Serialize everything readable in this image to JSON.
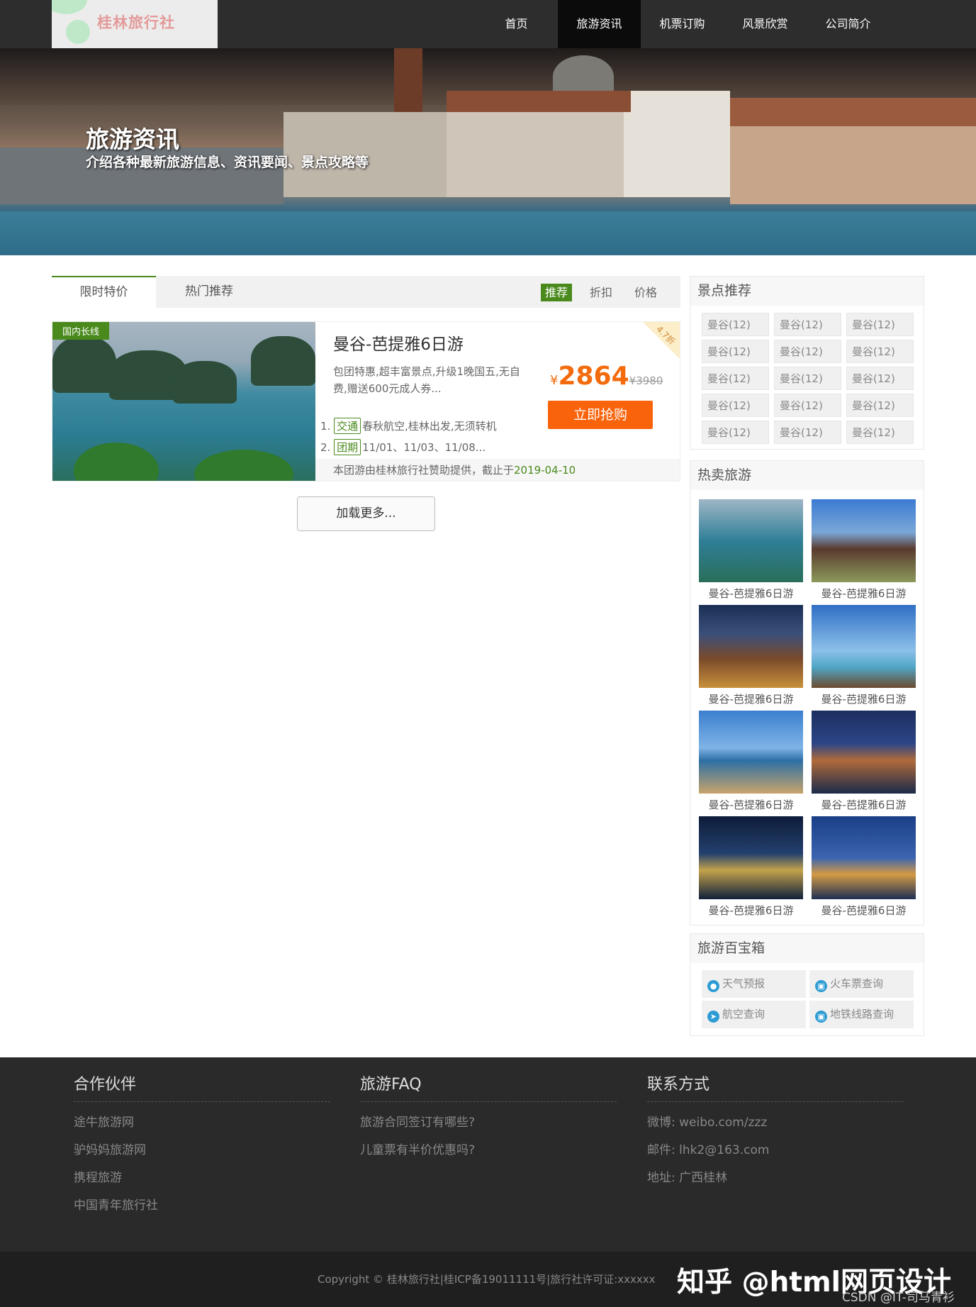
{
  "brand": {
    "logo_text": "桂林旅行社"
  },
  "nav": {
    "items": [
      "首页",
      "旅游资讯",
      "机票订购",
      "风景欣赏",
      "公司简介"
    ],
    "active_index": 1
  },
  "banner": {
    "title": "旅游资讯",
    "subtitle": "介绍各种最新旅游信息、资讯要闻、景点攻略等"
  },
  "tabs": {
    "items": [
      "限时特价",
      "热门推荐"
    ],
    "active_index": 0
  },
  "sorts": {
    "items": [
      "推荐",
      "折扣",
      "价格"
    ],
    "active_index": 0
  },
  "product": {
    "tag": "国内长线",
    "discount": "4.7折",
    "title": "曼谷-芭提雅6日游",
    "desc": "包团特惠,超丰富景点,升级1晚国五,无自费,赠送600元成人券...",
    "currency": "¥",
    "price": "2864",
    "old_price": "¥3980",
    "buy_label": "立即抢购",
    "features": [
      {
        "num": "1.",
        "label": "交通",
        "text": "春秋航空,桂林出发,无须转机"
      },
      {
        "num": "2.",
        "label": "团期",
        "text": "11/01、11/03、11/08..."
      }
    ],
    "foot_text": "本团游由桂林旅行社赞助提供，截止于",
    "foot_date": "2019-04-10"
  },
  "load_more": "加载更多...",
  "spots": {
    "title": "景点推荐",
    "items": [
      "曼谷(12)",
      "曼谷(12)",
      "曼谷(12)",
      "曼谷(12)",
      "曼谷(12)",
      "曼谷(12)",
      "曼谷(12)",
      "曼谷(12)",
      "曼谷(12)",
      "曼谷(12)",
      "曼谷(12)",
      "曼谷(12)",
      "曼谷(12)",
      "曼谷(12)",
      "曼谷(12)"
    ]
  },
  "hot": {
    "title": "热卖旅游",
    "items": [
      {
        "caption": "曼谷-芭提雅6日游",
        "scene": "bay"
      },
      {
        "caption": "曼谷-芭提雅6日游",
        "scene": "temple"
      },
      {
        "caption": "曼谷-芭提雅6日游",
        "scene": "night-temple"
      },
      {
        "caption": "曼谷-芭提雅6日游",
        "scene": "palm-beach"
      },
      {
        "caption": "曼谷-芭提雅6日游",
        "scene": "rock-beach"
      },
      {
        "caption": "曼谷-芭提雅6日游",
        "scene": "aqueduct"
      },
      {
        "caption": "曼谷-芭提雅6日游",
        "scene": "harbor-night"
      },
      {
        "caption": "曼谷-芭提雅6日游",
        "scene": "city-night"
      }
    ]
  },
  "toolbox": {
    "title": "旅游百宝箱",
    "items": [
      {
        "label": "天气预报",
        "icon": "location-icon"
      },
      {
        "label": "火车票查询",
        "icon": "train-icon"
      },
      {
        "label": "航空查询",
        "icon": "plane-icon"
      },
      {
        "label": "地铁线路查询",
        "icon": "metro-icon"
      }
    ]
  },
  "footer": {
    "partners": {
      "title": "合作伙伴",
      "items": [
        "途牛旅游网",
        "驴妈妈旅游网",
        "携程旅游",
        "中国青年旅行社"
      ]
    },
    "faq": {
      "title": "旅游FAQ",
      "items": [
        "旅游合同签订有哪些?",
        "儿童票有半价优惠吗?"
      ]
    },
    "contact": {
      "title": "联系方式",
      "items": [
        "微博: weibo.com/zzz",
        "邮件: lhk2@163.com",
        "地址: 广西桂林"
      ]
    }
  },
  "copyright": "Copyright © 桂林旅行社|桂ICP备19011111号|旅行社许可证:xxxxxx",
  "watermark": "知乎 @html网页设计",
  "csdn_mark": "CSDN @IT-司马青衫",
  "colors": {
    "accent": "#4a8a1c",
    "price": "#f36b0d",
    "buy": "#f8630b",
    "nav_bg": "#2d2d2d",
    "footer_bg": "#2a2a2a"
  }
}
